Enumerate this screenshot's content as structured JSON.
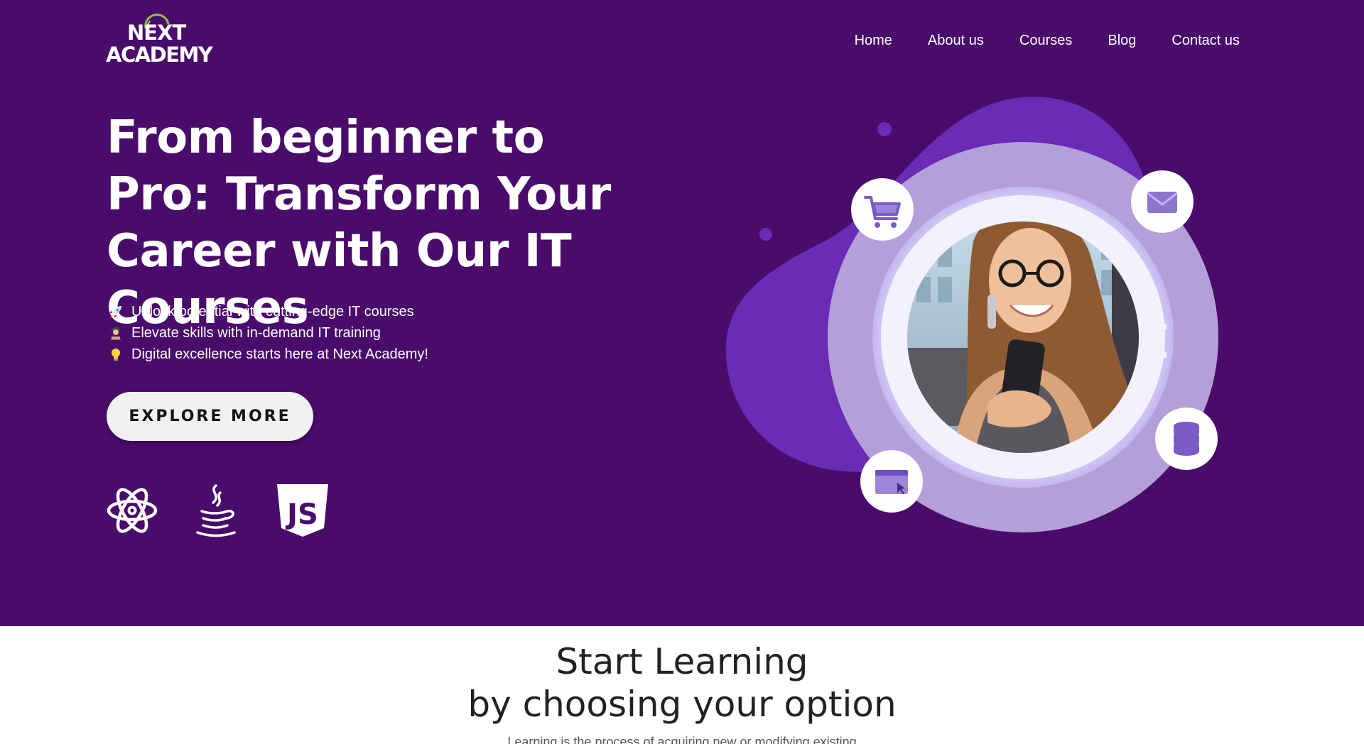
{
  "brand": {
    "line1": "NEXT",
    "line2": "ACADEMY",
    "arc_colors": [
      "#8dc63f",
      "#bfbfbf"
    ]
  },
  "nav": {
    "items": [
      "Home",
      "About us",
      "Courses",
      "Blog",
      "Contact us"
    ]
  },
  "hero": {
    "headline": "From beginner to Pro: Transform Your Career with Our IT Courses",
    "features": [
      {
        "icon": "rocket-icon",
        "text": "Unlock potential with cutting-edge IT courses"
      },
      {
        "icon": "student-icon",
        "text": "Elevate skills with in-demand IT training"
      },
      {
        "icon": "lightbulb-icon",
        "text": "Digital excellence starts here at Next Academy!"
      }
    ],
    "cta_label": "EXPLORE MORE",
    "tech_icons": [
      "react-icon",
      "java-icon",
      "javascript-icon"
    ],
    "js_badge_text": "JS"
  },
  "illustration": {
    "bubbles": [
      "shopping-cart-icon",
      "envelope-icon",
      "database-icon",
      "browser-window-icon"
    ]
  },
  "section": {
    "title_line1": "Start Learning",
    "title_line2": "by choosing your option",
    "text": "Learning is the process of acquiring new or modifying existing"
  },
  "colors": {
    "hero_bg": "#490c6a",
    "blob": "#6a2bb5",
    "ring": "#b59fd8",
    "icon_purple": "#7b5bc6",
    "button_bg": "#f1f1f1"
  }
}
